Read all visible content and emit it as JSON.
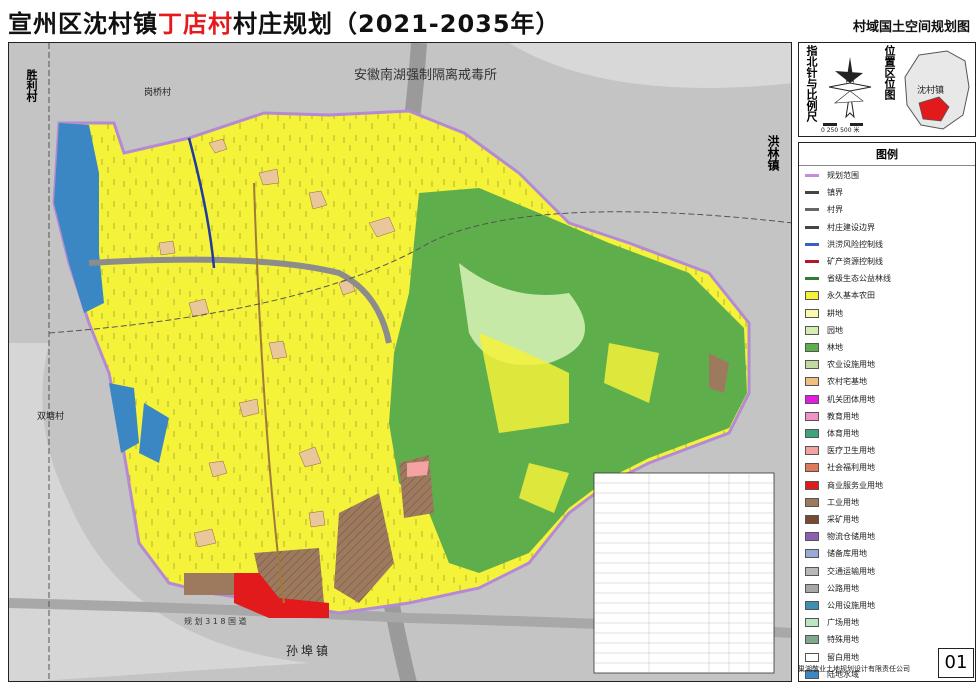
{
  "title": {
    "prefix": "宣州区沈村镇",
    "highlight": "丁店村",
    "suffix": "村庄规划（2021-2035年）",
    "subtitle": "村域国土空间规划图"
  },
  "map": {
    "place_labels": {
      "shengli": "胜利村",
      "gangqiao": "岗桥村",
      "hongge": "洪林镇",
      "shuangtang": "双塘村",
      "sunbu": "孙埠镇",
      "drug_rehab": "安徽南湖强制隔离戒毒所",
      "road": "规 划 3 1 8 国 道"
    },
    "compass_label": "指北针与比例尺",
    "location_label": "位置区位图",
    "locator_text": "沈村镇",
    "scale_text": "0    250    500 米",
    "colors": {
      "basic_farmland": "#f5f23a",
      "forest": "#5fae4c",
      "garden": "#c7e9a8",
      "water": "#3a87c4",
      "industrial": "#9d7a5e",
      "residential": "#e9c79a",
      "commercial": "#e31a1c",
      "boundary": "#b48ad4"
    }
  },
  "legend": {
    "title": "图例",
    "items": [
      {
        "label": "规划范围",
        "kind": "line",
        "color": "#c48be0"
      },
      {
        "label": "镇界",
        "kind": "line",
        "color": "#444"
      },
      {
        "label": "村界",
        "kind": "line",
        "color": "#666"
      },
      {
        "label": "村庄建设边界",
        "kind": "line",
        "color": "#444"
      },
      {
        "label": "洪涝风险控制线",
        "kind": "line",
        "color": "#3a5fcd"
      },
      {
        "label": "矿产资源控制线",
        "kind": "line",
        "color": "#b2182b"
      },
      {
        "label": "省级生态公益林线",
        "kind": "line",
        "color": "#2e7d32"
      },
      {
        "label": "永久基本农田",
        "kind": "fill",
        "color": "#f5f23a"
      },
      {
        "label": "耕地",
        "kind": "fill",
        "color": "#fbf8b0"
      },
      {
        "label": "园地",
        "kind": "fill",
        "color": "#d4edb0"
      },
      {
        "label": "林地",
        "kind": "fill",
        "color": "#5fae4c"
      },
      {
        "label": "农业设施用地",
        "kind": "fill",
        "color": "#c2d9a0"
      },
      {
        "label": "农村宅基地",
        "kind": "fill",
        "color": "#f0c080"
      },
      {
        "label": "机关团体用地",
        "kind": "fill",
        "color": "#e31ae0"
      },
      {
        "label": "教育用地",
        "kind": "fill",
        "color": "#f094c8"
      },
      {
        "label": "体育用地",
        "kind": "fill",
        "color": "#3fa37e"
      },
      {
        "label": "医疗卫生用地",
        "kind": "fill",
        "color": "#f4a3a3"
      },
      {
        "label": "社会福利用地",
        "kind": "fill",
        "color": "#e0785a"
      },
      {
        "label": "商业服务业用地",
        "kind": "fill",
        "color": "#e31a1c"
      },
      {
        "label": "工业用地",
        "kind": "fill",
        "color": "#9d7a5e"
      },
      {
        "label": "采矿用地",
        "kind": "fill",
        "color": "#7a4a2e"
      },
      {
        "label": "物流仓储用地",
        "kind": "fill",
        "color": "#8e5fb0"
      },
      {
        "label": "储备库用地",
        "kind": "fill",
        "color": "#9aa9d8"
      },
      {
        "label": "交通运输用地",
        "kind": "fill",
        "color": "#b8b8b8"
      },
      {
        "label": "公路用地",
        "kind": "fill",
        "color": "#a7a7a7"
      },
      {
        "label": "公用设施用地",
        "kind": "fill",
        "color": "#3f8fb5"
      },
      {
        "label": "广场用地",
        "kind": "fill",
        "color": "#b9e6c3"
      },
      {
        "label": "特殊用地",
        "kind": "fill",
        "color": "#7ea98a"
      },
      {
        "label": "留白用地",
        "kind": "fill",
        "color": "#ffffff"
      },
      {
        "label": "陆地水域",
        "kind": "fill",
        "color": "#3a87c4"
      }
    ]
  },
  "company": "巢湖敬业土地规划设计有限责任公司",
  "sheet_no": "01"
}
